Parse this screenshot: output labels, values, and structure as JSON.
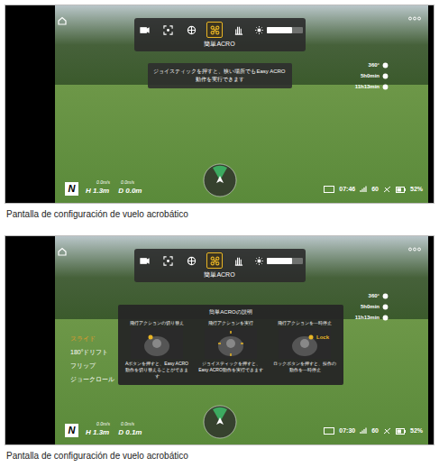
{
  "figures": [
    {
      "toolbar": {
        "items": [
          {
            "kind": "video",
            "selected": false
          },
          {
            "kind": "frame",
            "selected": false
          },
          {
            "kind": "gimbal",
            "selected": false
          },
          {
            "kind": "acro",
            "selected": true
          },
          {
            "kind": "hand",
            "selected": false
          }
        ],
        "brightness_level": 0.7,
        "mode_label": "簡単ACRO"
      },
      "tooltip": "ジョイスティックを押すと、狭い場所でもEasy ACRO動作を実行できます",
      "panel": null,
      "menu": [],
      "right_stats": [
        "360°",
        "5h0min",
        "11h13min"
      ],
      "telemetry": {
        "speed_h": "0.0m/s",
        "speed_v": "0.0m/s",
        "height": "H 1.3m",
        "distance": "D 0.0m"
      },
      "logo": "N",
      "status": {
        "time": "07:46",
        "fps": "60",
        "battery": "52%"
      },
      "caption": "Pantalla de configuración de vuelo acrobático"
    },
    {
      "toolbar": {
        "items": [
          {
            "kind": "video",
            "selected": false
          },
          {
            "kind": "frame",
            "selected": false
          },
          {
            "kind": "gimbal",
            "selected": false
          },
          {
            "kind": "acro",
            "selected": true
          },
          {
            "kind": "hand",
            "selected": false
          }
        ],
        "brightness_level": 0.7,
        "mode_label": "簡単ACRO"
      },
      "tooltip": null,
      "panel": {
        "title": "簡単ACROの説明",
        "columns": [
          {
            "heading": "飛行アクションの切り替え",
            "text": "Aボタンを押すと、Easy ACRO動作を切り替えることができます",
            "badge": null
          },
          {
            "heading": "飛行アクションを実行",
            "text": "ジョイスティックを押すと、Easy ACRO動作を実行できます",
            "badge": null
          },
          {
            "heading": "飛行アクションを一時停止",
            "text": "ロックボタンを押すと、操作の動作を一時停止",
            "badge": "Lock"
          }
        ]
      },
      "menu": [
        {
          "label": "スライド",
          "selected": true
        },
        {
          "label": "180°ドリフト",
          "selected": false
        },
        {
          "label": "フリップ",
          "selected": false
        },
        {
          "label": "ジョークロール",
          "selected": false
        }
      ],
      "right_stats": [
        "360°",
        "5h0min",
        "11h13min"
      ],
      "telemetry": {
        "speed_h": "0.0m/s",
        "speed_v": "0.0m/s",
        "height": "H 1.3m",
        "distance": "D 0.1m"
      },
      "logo": "N",
      "status": {
        "time": "07:30",
        "fps": "60",
        "battery": "52%"
      },
      "caption": "Pantalla de configuración de vuelo acrobático"
    }
  ]
}
